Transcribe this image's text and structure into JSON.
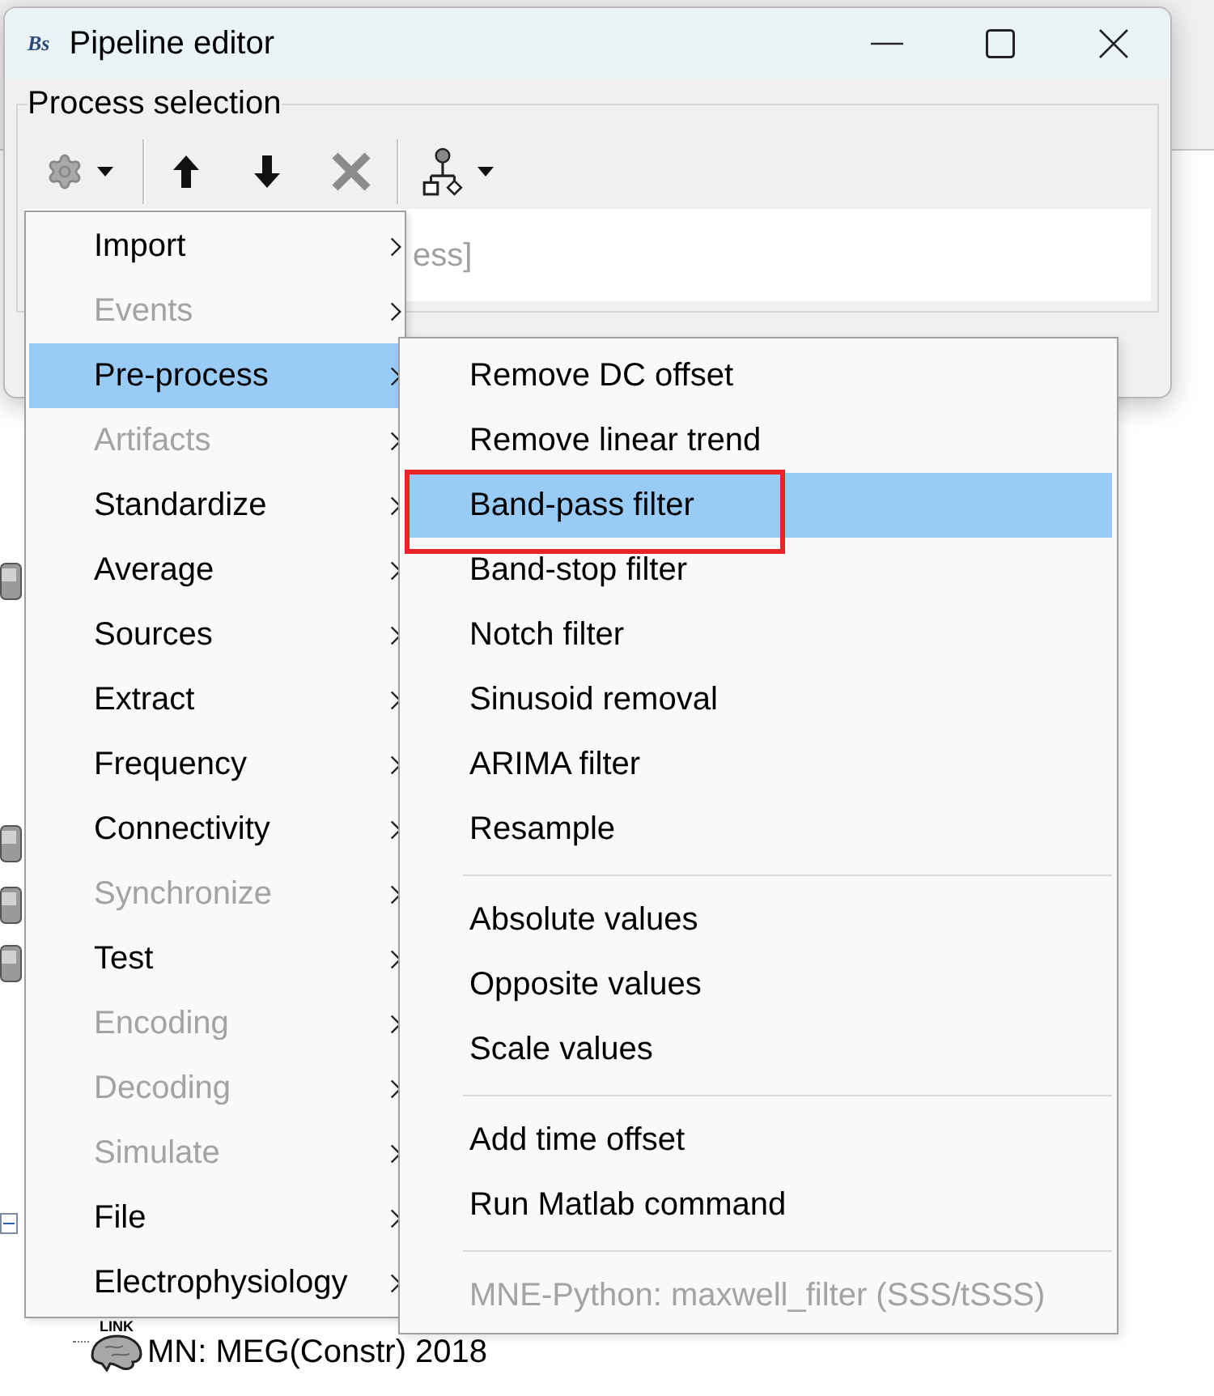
{
  "window": {
    "logo": "Bs",
    "title": "Pipeline editor"
  },
  "process_selection": {
    "title": "Process selection",
    "list_text": "ess]"
  },
  "menu": {
    "items": [
      {
        "label": "Import",
        "disabled": false,
        "selected": false
      },
      {
        "label": "Events",
        "disabled": true,
        "selected": false
      },
      {
        "label": "Pre-process",
        "disabled": false,
        "selected": true
      },
      {
        "label": "Artifacts",
        "disabled": true,
        "selected": false
      },
      {
        "label": "Standardize",
        "disabled": false,
        "selected": false
      },
      {
        "label": "Average",
        "disabled": false,
        "selected": false
      },
      {
        "label": "Sources",
        "disabled": false,
        "selected": false
      },
      {
        "label": "Extract",
        "disabled": false,
        "selected": false
      },
      {
        "label": "Frequency",
        "disabled": false,
        "selected": false
      },
      {
        "label": "Connectivity",
        "disabled": false,
        "selected": false
      },
      {
        "label": "Synchronize",
        "disabled": true,
        "selected": false
      },
      {
        "label": "Test",
        "disabled": false,
        "selected": false
      },
      {
        "label": "Encoding",
        "disabled": true,
        "selected": false
      },
      {
        "label": "Decoding",
        "disabled": true,
        "selected": false
      },
      {
        "label": "Simulate",
        "disabled": true,
        "selected": false
      },
      {
        "label": "File",
        "disabled": false,
        "selected": false
      },
      {
        "label": "Electrophysiology",
        "disabled": false,
        "selected": false
      }
    ]
  },
  "submenu": {
    "groups": [
      {
        "items": [
          {
            "label": "Remove DC offset",
            "disabled": false,
            "selected": false,
            "annotated": false
          },
          {
            "label": "Remove linear trend",
            "disabled": false,
            "selected": false,
            "annotated": false
          },
          {
            "label": "Band-pass filter",
            "disabled": false,
            "selected": true,
            "annotated": true
          },
          {
            "label": "Band-stop filter",
            "disabled": false,
            "selected": false,
            "annotated": false
          },
          {
            "label": "Notch filter",
            "disabled": false,
            "selected": false,
            "annotated": false
          },
          {
            "label": "Sinusoid removal",
            "disabled": false,
            "selected": false,
            "annotated": false
          },
          {
            "label": "ARIMA filter",
            "disabled": false,
            "selected": false,
            "annotated": false
          },
          {
            "label": "Resample",
            "disabled": false,
            "selected": false,
            "annotated": false
          }
        ]
      },
      {
        "items": [
          {
            "label": "Absolute values",
            "disabled": false,
            "selected": false,
            "annotated": false
          },
          {
            "label": "Opposite values",
            "disabled": false,
            "selected": false,
            "annotated": false
          },
          {
            "label": "Scale values",
            "disabled": false,
            "selected": false,
            "annotated": false
          }
        ]
      },
      {
        "items": [
          {
            "label": "Add time offset",
            "disabled": false,
            "selected": false,
            "annotated": false
          },
          {
            "label": "Run Matlab command",
            "disabled": false,
            "selected": false,
            "annotated": false
          }
        ]
      },
      {
        "items": [
          {
            "label": "MNE-Python: maxwell_filter (SSS/tSSS)",
            "disabled": true,
            "selected": false,
            "annotated": false
          }
        ]
      }
    ]
  },
  "tree": {
    "node": {
      "badge": "LINK",
      "label": "MN: MEG(Constr) 2018"
    }
  }
}
